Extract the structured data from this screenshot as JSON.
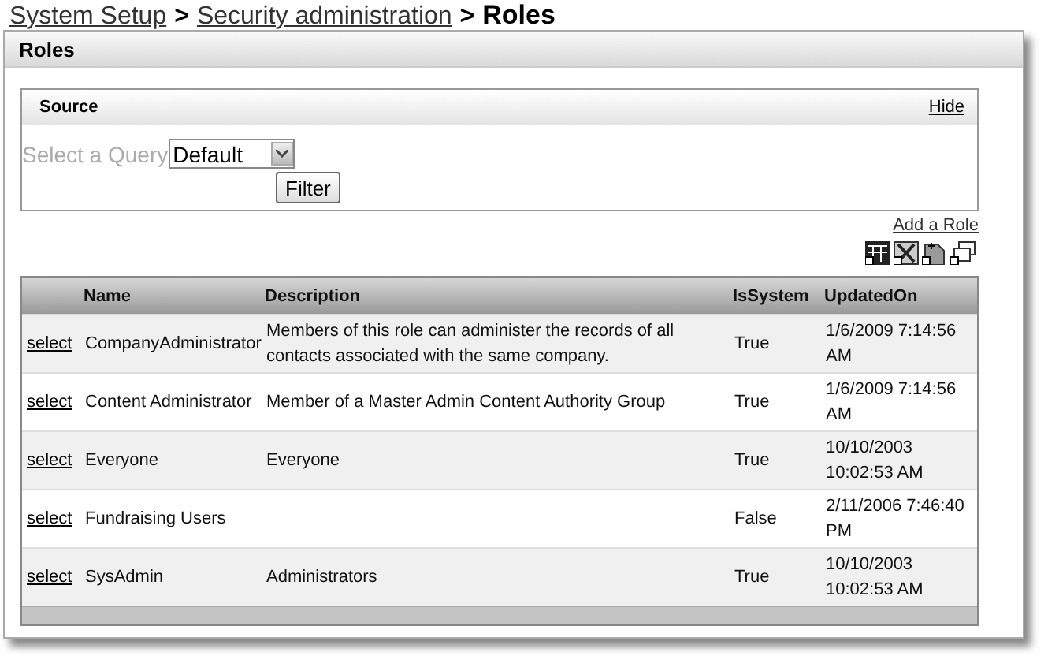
{
  "breadcrumb": [
    {
      "kind": "link",
      "label": "System Setup"
    },
    {
      "kind": "separator",
      "label": ">"
    },
    {
      "kind": "link",
      "label": "Security administration"
    },
    {
      "kind": "separator",
      "label": ">"
    },
    {
      "kind": "current",
      "label": "Roles"
    }
  ],
  "panel": {
    "title": "Roles"
  },
  "source": {
    "title": "Source",
    "hide_link": "Hide",
    "query_label": "Select a Query",
    "query_value": "Default",
    "filter_button": "Filter"
  },
  "add_link": "Add a Role",
  "table": {
    "columns": [
      "Name",
      "Description",
      "IsSystem",
      "UpdatedOn"
    ],
    "rows": [
      {
        "action": "select",
        "name": "CompanyAdministrator",
        "description": "Members of this role can administer the records of all contacts associated with the same company.",
        "is_system": "True",
        "updated_on": "1/6/2009 7:14:56 AM"
      },
      {
        "action": "select",
        "name": "Content Administrator",
        "description": "Member of a Master Admin Content Authority Group",
        "is_system": "True",
        "updated_on": "1/6/2009 7:14:56 AM"
      },
      {
        "action": "select",
        "name": "Everyone",
        "description": "Everyone",
        "is_system": "True",
        "updated_on": "10/10/2003 10:02:53 AM"
      },
      {
        "action": "select",
        "name": "Fundraising Users",
        "is_system": "False",
        "updated_on": "2/11/2006 7:46:40 PM"
      },
      {
        "action": "select",
        "name": "SysAdmin",
        "description": "Administrators",
        "is_system": "True",
        "updated_on": "10/10/2003 10:02:53 AM"
      }
    ]
  }
}
